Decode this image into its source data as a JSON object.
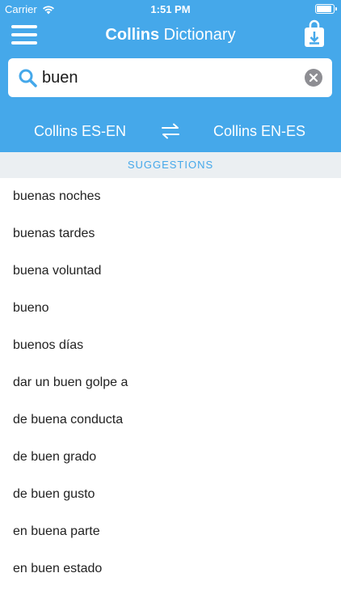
{
  "status_bar": {
    "carrier": "Carrier",
    "time": "1:51 PM"
  },
  "nav": {
    "title_bold": "Collins",
    "title_regular": "Dictionary"
  },
  "search": {
    "value": "buen",
    "placeholder": ""
  },
  "dictionaries": {
    "left": "Collins ES-EN",
    "right": "Collins EN-ES"
  },
  "suggestions": {
    "header": "SUGGESTIONS",
    "items": [
      "buenas noches",
      "buenas tardes",
      "buena voluntad",
      "bueno",
      "buenos días",
      "dar un buen golpe a",
      "de buena conducta",
      "de buen grado",
      "de buen gusto",
      "en buena parte",
      "en buen estado"
    ]
  },
  "colors": {
    "accent": "#45a8ea",
    "section_bg": "#ebeff2",
    "clear_button": "#8e8e93"
  },
  "icons": {
    "menu": "hamburger-menu-icon",
    "download": "download-bag-icon",
    "search": "search-icon",
    "clear": "clear-icon",
    "swap": "swap-arrows-icon",
    "wifi": "wifi-icon",
    "battery": "battery-icon"
  }
}
